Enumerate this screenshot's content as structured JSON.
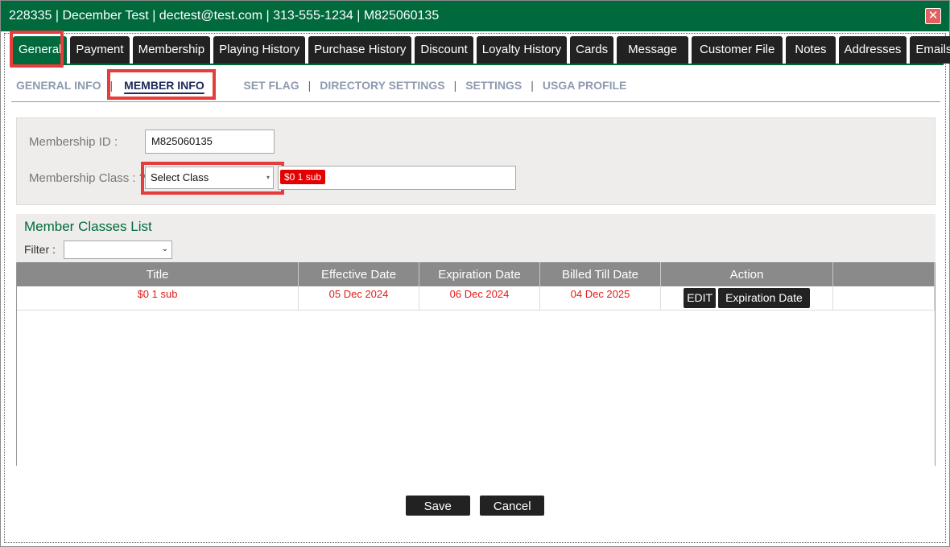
{
  "window": {
    "title": "228335 | December Test | dectest@test.com | 313-555-1234 | M825060135",
    "close_symbol": "✕"
  },
  "tabs": [
    {
      "label": "General",
      "active": true
    },
    {
      "label": "Payment"
    },
    {
      "label": "Membership"
    },
    {
      "label": "Playing History"
    },
    {
      "label": "Purchase History"
    },
    {
      "label": "Discount"
    },
    {
      "label": "Loyalty History"
    },
    {
      "label": "Cards"
    },
    {
      "label": "Message"
    },
    {
      "label": "Customer File"
    },
    {
      "label": "Notes"
    },
    {
      "label": "Addresses"
    },
    {
      "label": "Emails"
    }
  ],
  "subnav": {
    "items": [
      "GENERAL INFO",
      "MEMBER INFO",
      "SET FLAG",
      "DIRECTORY SETTINGS",
      "SETTINGS",
      "USGA PROFILE"
    ],
    "active": "MEMBER INFO",
    "separator": "|"
  },
  "form": {
    "membership_id_label": "Membership ID :",
    "membership_id_value": "M825060135",
    "membership_class_label": "Membership Class : ?",
    "membership_class_placeholder": "Select Class",
    "selected_tag": "$0 1 sub",
    "dropdown_arrow": "▾"
  },
  "member_classes": {
    "title": "Member Classes List",
    "filter_label": "Filter :",
    "filter_arrow": "⌄",
    "columns": [
      "Title",
      "Effective Date",
      "Expiration Date",
      "Billed Till Date",
      "Action"
    ],
    "rows": [
      {
        "title": "$0 1 sub",
        "effective": "05 Dec 2024",
        "expiration": "06 Dec 2024",
        "billed_till": "04 Dec 2025",
        "actions": [
          "EDIT",
          "Expiration Date"
        ]
      }
    ]
  },
  "footer": {
    "save_label": "Save",
    "cancel_label": "Cancel"
  },
  "colors": {
    "brand_green": "#006a3c",
    "highlight_red": "#e53d3d",
    "tag_red": "#e50000",
    "tab_dark": "#222222"
  }
}
